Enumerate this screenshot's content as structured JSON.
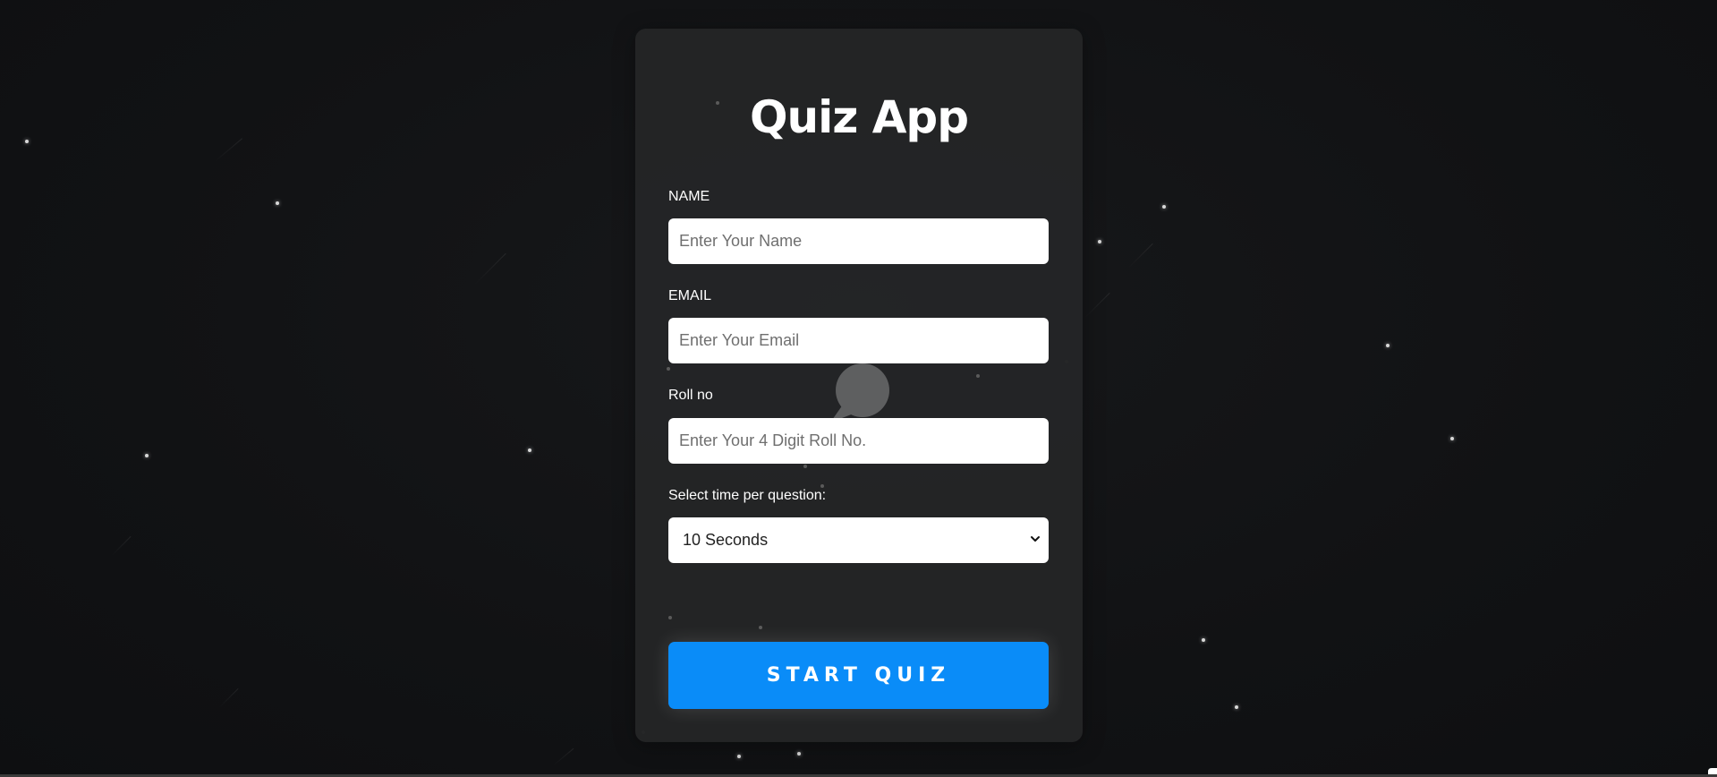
{
  "app": {
    "title": "Quiz App"
  },
  "form": {
    "name": {
      "label": "NAME",
      "placeholder": "Enter Your Name",
      "value": ""
    },
    "email": {
      "label": "EMAIL",
      "placeholder": "Enter Your Email",
      "value": ""
    },
    "roll": {
      "label": "Roll no",
      "placeholder": "Enter Your 4 Digit Roll No.",
      "value": ""
    },
    "time": {
      "label": "Select time per question:",
      "selected": "10 Seconds"
    },
    "start_label": "START QUIZ"
  },
  "colors": {
    "background": "#111214",
    "card": "#242526",
    "accent": "#0a8cf8",
    "text": "#ffffff"
  },
  "icons": {
    "select_chevron": "chevron-down-icon",
    "center_decoration": "chat-bubble-icon",
    "corner": "chat-widget-icon"
  }
}
